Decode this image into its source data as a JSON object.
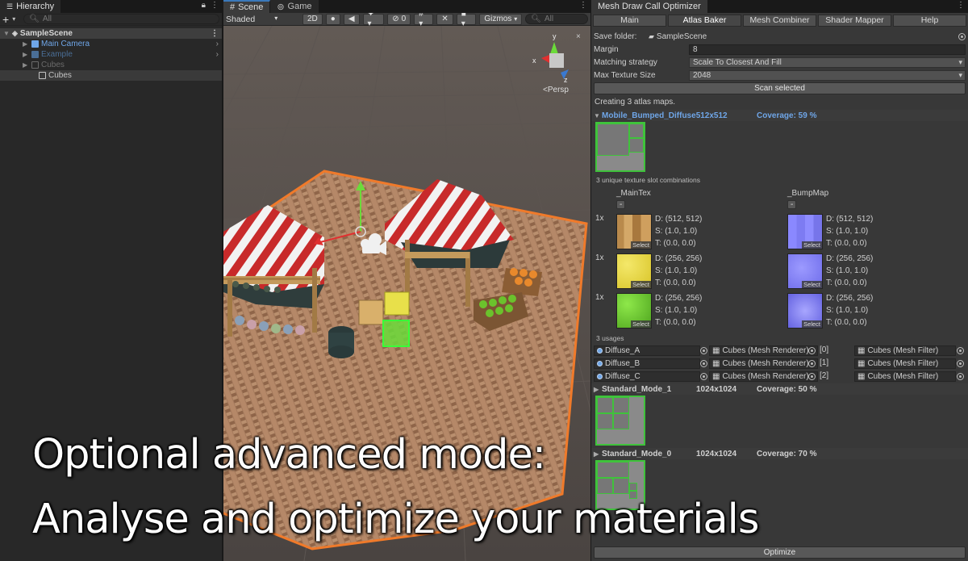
{
  "hierarchy": {
    "tab": "Hierarchy",
    "add": "+",
    "search_placeholder": "All",
    "scene": "SampleScene",
    "items": [
      {
        "label": "Main Camera"
      },
      {
        "label": "Example"
      },
      {
        "label": "Cubes"
      },
      {
        "label": "Cubes"
      }
    ]
  },
  "scene": {
    "tabs": [
      "Scene",
      "Game"
    ],
    "shading": "Shaded",
    "mode_2d": "2D",
    "hidden_count": "0",
    "gizmos": "Gizmos",
    "search_placeholder": "All",
    "persp": "Persp",
    "axis": {
      "x": "x",
      "y": "y",
      "z": "z"
    }
  },
  "optimizer": {
    "title": "Mesh Draw Call Optimizer",
    "tabs": [
      "Main",
      "Atlas Baker",
      "Mesh Combiner",
      "Shader Mapper",
      "Help"
    ],
    "fields": {
      "save_folder_label": "Save folder:",
      "save_folder_value": "SampleScene",
      "margin_label": "Margin",
      "margin_value": "8",
      "matching_label": "Matching strategy",
      "matching_value": "Scale To Closest And Fill",
      "max_tex_label": "Max Texture Size",
      "max_tex_value": "2048"
    },
    "scan_button": "Scan selected",
    "status": "Creating 3 atlas maps.",
    "atlases": [
      {
        "name": "Mobile_Bumped_Diffuse",
        "size": "512x512",
        "coverage": "Coverage: 59 %"
      },
      {
        "name": "Standard_Mode_1",
        "size": "1024x1024",
        "coverage": "Coverage: 50 %"
      },
      {
        "name": "Standard_Mode_0",
        "size": "1024x1024",
        "coverage": "Coverage: 70 %"
      }
    ],
    "combinations_label": "3 unique texture slot combinations",
    "slots": [
      "_MainTex",
      "_BumpMap"
    ],
    "slot_button": "-",
    "rows": [
      {
        "count": "1x",
        "main": {
          "d": "D: (512, 512)",
          "s": "S: (1.0, 1.0)",
          "t": "T: (0.0, 0.0)"
        },
        "bump": {
          "d": "D: (512, 512)",
          "s": "S: (1.0, 1.0)",
          "t": "T: (0.0, 0.0)"
        }
      },
      {
        "count": "1x",
        "main": {
          "d": "D: (256, 256)",
          "s": "S: (1.0, 1.0)",
          "t": "T: (0.0, 0.0)"
        },
        "bump": {
          "d": "D: (256, 256)",
          "s": "S: (1.0, 1.0)",
          "t": "T: (0.0, 0.0)"
        }
      },
      {
        "count": "1x",
        "main": {
          "d": "D: (256, 256)",
          "s": "S: (1.0, 1.0)",
          "t": "T: (0.0, 0.0)"
        },
        "bump": {
          "d": "D: (256, 256)",
          "s": "S: (1.0, 1.0)",
          "t": "T: (0.0, 0.0)"
        }
      }
    ],
    "select_label": "Select",
    "usages_label": "3 usages",
    "usages": [
      {
        "material": "Diffuse_A",
        "renderer": "Cubes (Mesh Renderer)",
        "index": "[0]",
        "filter": "Cubes (Mesh Filter)"
      },
      {
        "material": "Diffuse_B",
        "renderer": "Cubes (Mesh Renderer)",
        "index": "[1]",
        "filter": "Cubes (Mesh Filter)"
      },
      {
        "material": "Diffuse_C",
        "renderer": "Cubes (Mesh Renderer)",
        "index": "[2]",
        "filter": "Cubes (Mesh Filter)"
      }
    ],
    "optimize_button": "Optimize"
  },
  "overlay": {
    "line1": "Optional advanced mode:",
    "line2": "Analyse and optimize your materials"
  }
}
